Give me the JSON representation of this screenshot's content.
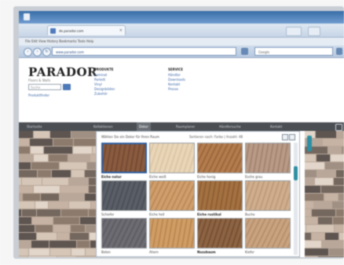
{
  "browser": {
    "tab_title": "de.parador.com",
    "url": "www.parador.com",
    "search_placeholder": "Google",
    "menu": "File  Edit  View  History  Bookmarks  Tools  Help"
  },
  "site": {
    "logo": "PARADOR",
    "tagline": "Floors & Walls",
    "search_placeholder": "Suche",
    "side_link": "Produktfinder",
    "columns": [
      {
        "head": "PRODUKTE",
        "links": [
          "Laminat",
          "Parkett",
          "Vinyl",
          "Designböden",
          "Zubehör"
        ]
      },
      {
        "head": "SERVICE",
        "links": [
          "Händler",
          "Downloads",
          "Kontakt",
          "Presse"
        ]
      }
    ],
    "nav": [
      "Startseite",
      "Kollektionen",
      "Dekor",
      "Raumplaner",
      "Händlersuche",
      "Kontakt"
    ],
    "nav_active": "Dekor"
  },
  "dialog": {
    "header": "Wählen Sie ein Dekor für Ihren Raum",
    "filter": "Sortieren nach: Farbe  |  Anzahl: 48",
    "swatches": [
      {
        "label": "Eiche natur",
        "color": "#8a5b3e",
        "grain": "#6e4630",
        "selected": true,
        "bold": true
      },
      {
        "label": "Eiche weiß",
        "color": "#e9d6b8",
        "grain": "#d8c2a0"
      },
      {
        "label": "Eiche honig",
        "color": "#b47c4c",
        "grain": "#93603a"
      },
      {
        "label": "Esche grau",
        "color": "#b89a86",
        "grain": "#9c7e6c"
      },
      {
        "label": "Schiefer",
        "color": "#5a5e66",
        "grain": "#474b52"
      },
      {
        "label": "Eiche hell",
        "color": "#cf9e6c",
        "grain": "#b6844f"
      },
      {
        "label": "Eiche rustikal",
        "color": "#a47141",
        "grain": "#875a30",
        "bold": true
      },
      {
        "label": "Buche",
        "color": "#cfae8e",
        "grain": "#b89575"
      },
      {
        "label": "Beton",
        "color": "#6d6c72",
        "grain": "#59585e"
      },
      {
        "label": "Ahorn",
        "color": "#d09d65",
        "grain": "#b6824c"
      },
      {
        "label": "Nussbaum",
        "color": "#8d6443",
        "grain": "#6f4a2f",
        "bold": true
      },
      {
        "label": "Kiefer",
        "color": "#c9a380",
        "grain": "#b08a66"
      }
    ]
  },
  "floor_colors": [
    "#5e5450",
    "#8c7b6d",
    "#b9a79a",
    "#d6c6b8",
    "#a09084",
    "#74675e",
    "#c7b3a3",
    "#e2d5c9"
  ]
}
